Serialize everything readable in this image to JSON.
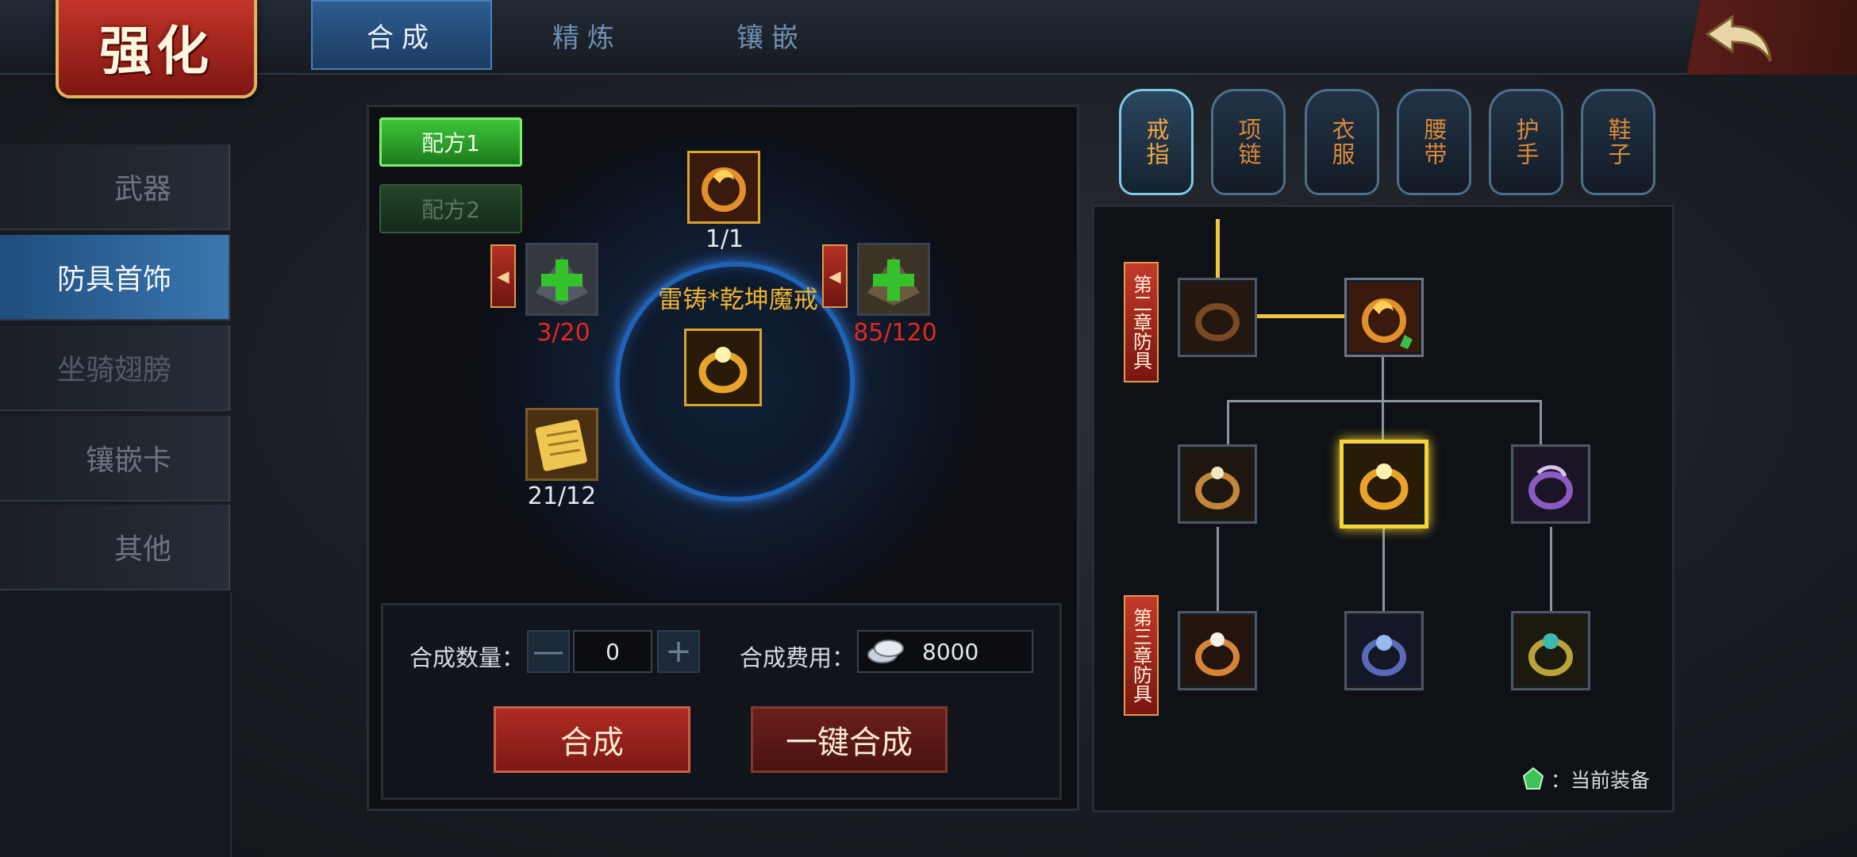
{
  "header": {
    "title": "强化",
    "tabs": [
      {
        "label": "合成",
        "active": true
      },
      {
        "label": "精炼",
        "active": false
      },
      {
        "label": "镶嵌",
        "active": false
      }
    ],
    "back_icon": "undo-arrow-icon"
  },
  "sidebar": {
    "items": [
      {
        "label": "武器",
        "active": false
      },
      {
        "label": "防具首饰",
        "active": true
      },
      {
        "label": "坐骑翅膀",
        "active": false
      },
      {
        "label": "镶嵌卡",
        "active": false
      },
      {
        "label": "其他",
        "active": false
      }
    ]
  },
  "recipe": {
    "formulas": [
      "配方1",
      "配方2"
    ],
    "target_count": "1/1",
    "target_name": "雷铸*乾坤魔戒",
    "left_material_count": "3/20",
    "right_material_count": "85/120",
    "scroll_count": "21/12"
  },
  "controls": {
    "quantity_label": "合成数量：",
    "quantity_value": "0",
    "cost_label": "合成费用：",
    "cost_value": "8000",
    "synth_label": "合成",
    "onekey_label": "一键合成"
  },
  "categories": [
    "戒指",
    "项链",
    "衣服",
    "腰带",
    "护手",
    "鞋子"
  ],
  "tree": {
    "chapter_2": "第二章防具",
    "chapter_3": "第三章防具",
    "legend": "：当前装备"
  },
  "colors": {
    "accent_gold": "#f6d339",
    "count_red": "#e2291f",
    "active_blue": "#2d5d8f"
  }
}
